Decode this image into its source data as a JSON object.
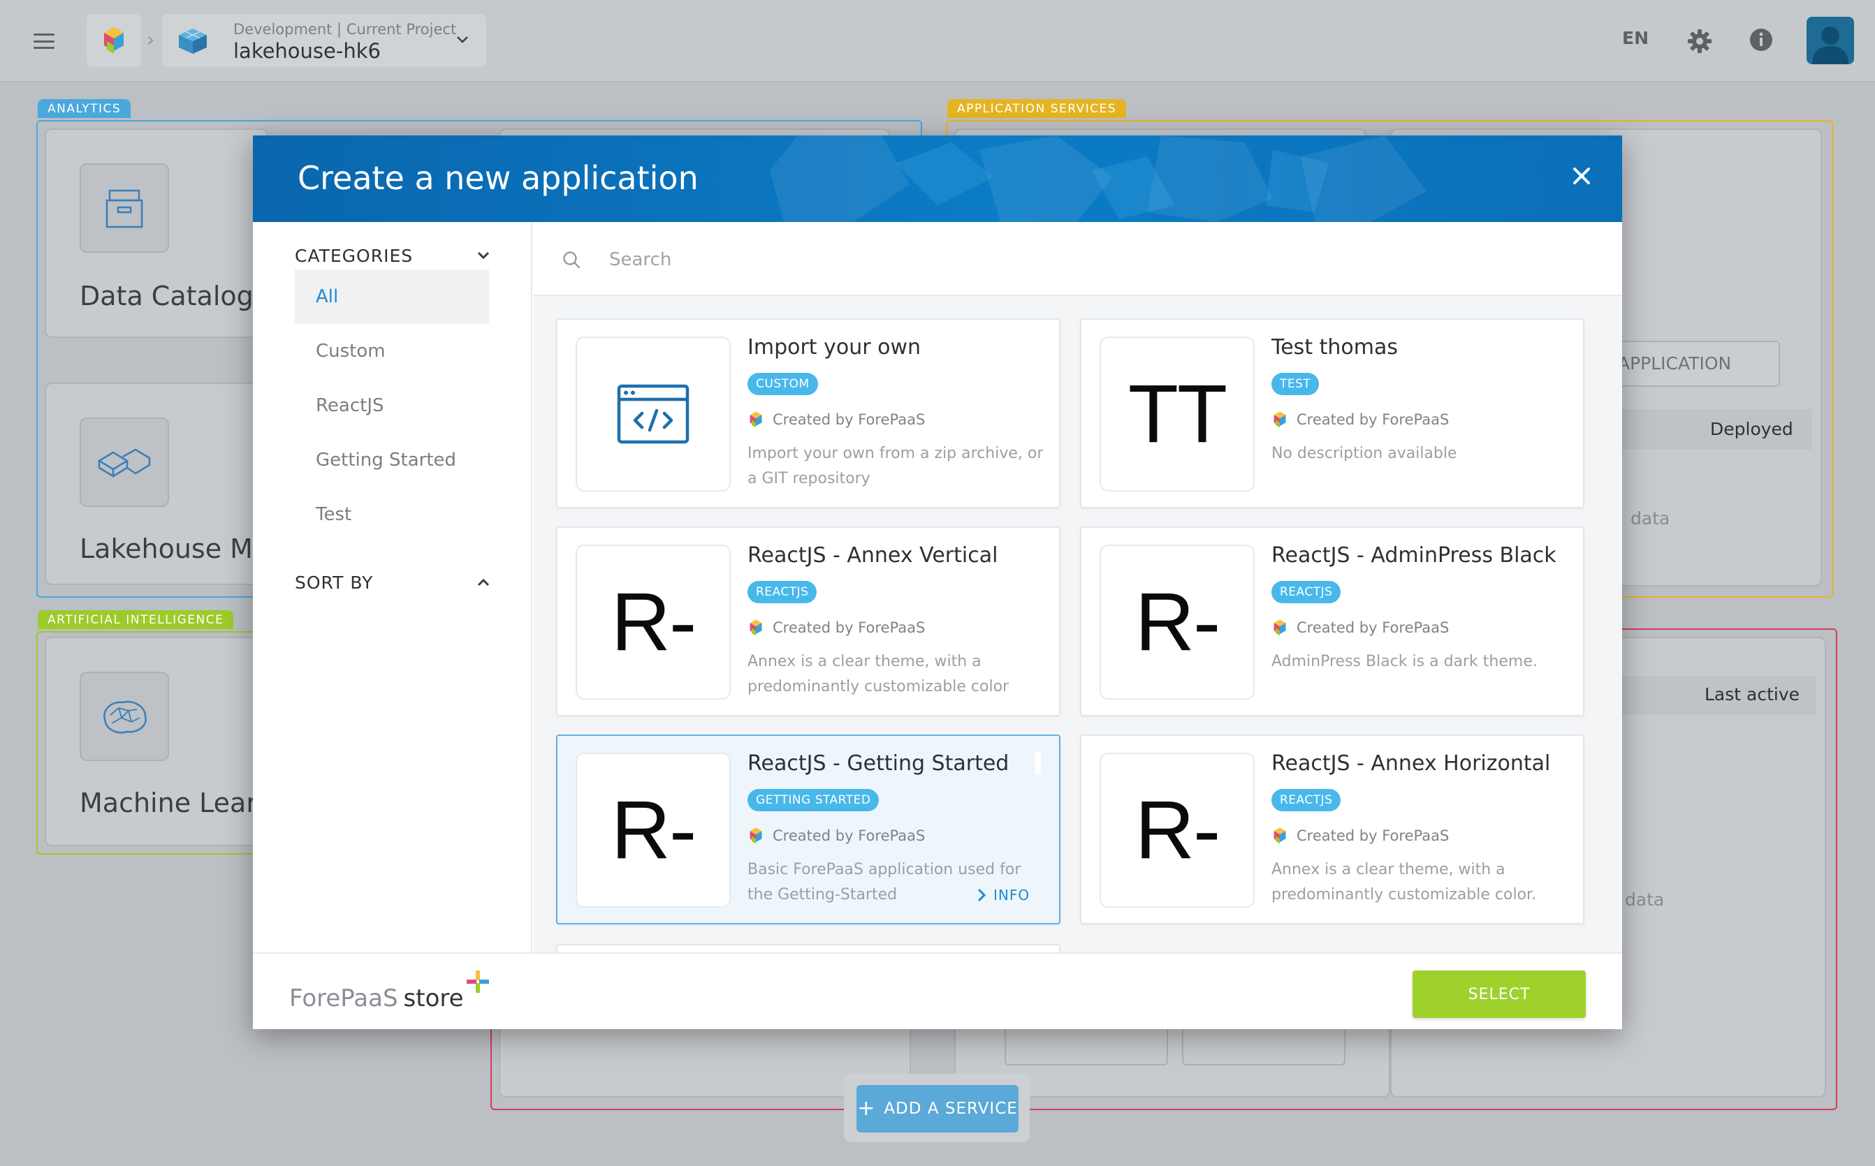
{
  "topbar": {
    "breadcrumb_sub": "Development | Current Project",
    "project_name": "lakehouse-hk6",
    "language": "EN"
  },
  "background": {
    "sections": {
      "analytics": "ANALYTICS",
      "application_services": "APPLICATION SERVICES",
      "ai": "ARTIFICIAL INTELLIGENCE"
    },
    "cards": {
      "data_catalog": "Data Catalog",
      "lakehouse": "Lakehouse Mar",
      "machine_learning": "Machine Learni"
    },
    "right_panel": {
      "button": "APPLICATION",
      "deployed": "Deployed",
      "data_1": "data",
      "last_active": "Last active",
      "data_2": "data"
    },
    "add_service": "ADD A SERVICE"
  },
  "modal": {
    "title": "Create a new application",
    "categories_header": "CATEGORIES",
    "categories": [
      "All",
      "Custom",
      "ReactJS",
      "Getting Started",
      "Test"
    ],
    "sort_header": "SORT BY",
    "search_placeholder": "Search",
    "cards": [
      {
        "title": "Import your own",
        "badge": "CUSTOM",
        "creator": "Created by ForePaaS",
        "desc": "Import your own from a zip archive, or a GIT repository",
        "thumb": "code-window"
      },
      {
        "title": "Test thomas",
        "badge": "TEST",
        "creator": "Created by ForePaaS",
        "desc": "No description available",
        "thumb": "TT"
      },
      {
        "title": "ReactJS - Annex Vertical",
        "badge": "REACTJS",
        "creator": "Created by ForePaaS",
        "desc": "Annex is a clear theme, with a predominantly customizable color",
        "thumb": "R-"
      },
      {
        "title": "ReactJS - AdminPress Black",
        "badge": "REACTJS",
        "creator": "Created by ForePaaS",
        "desc": "AdminPress Black is a dark theme.",
        "thumb": "R-"
      },
      {
        "title": "ReactJS - Getting Started",
        "badge": "GETTING STARTED",
        "creator": "Created by ForePaaS",
        "desc": "Basic ForePaaS application used for the Getting-Started",
        "thumb": "R-",
        "info": "INFO"
      },
      {
        "title": "ReactJS - Annex Horizontal",
        "badge": "REACTJS",
        "creator": "Created by ForePaaS",
        "desc": "Annex is a clear theme, with a predominantly customizable color.",
        "thumb": "R-"
      }
    ],
    "footer": {
      "brand": "ForePaaS",
      "store": "store",
      "select": "SELECT"
    }
  },
  "colors": {
    "brand_blue": "#0b6fb8",
    "badge_blue": "#48b8ea",
    "select_green": "#9fd12d",
    "analytics": "#4aa8dc",
    "app_services": "#e6b422",
    "ai": "#9ccb2a",
    "red_section": "#dc3b57"
  }
}
